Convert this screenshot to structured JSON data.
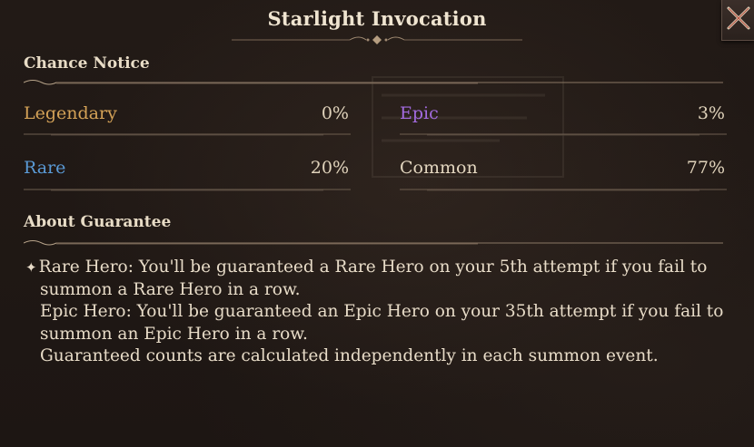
{
  "header": {
    "title": "Starlight Invocation"
  },
  "chance_notice": {
    "heading": "Chance Notice",
    "rates": [
      {
        "label": "Legendary",
        "value": "0%",
        "color": "#d4a257"
      },
      {
        "label": "Epic",
        "value": "3%",
        "color": "#a36be0"
      },
      {
        "label": "Rare",
        "value": "20%",
        "color": "#5a9ad6"
      },
      {
        "label": "Common",
        "value": "77%",
        "color": "#e3d6bf"
      }
    ]
  },
  "guarantee": {
    "heading": "About Guarantee",
    "bullet_icon": "diamond-bullet",
    "lines": [
      "Rare Hero: You'll be guaranteed a Rare Hero on your 5th attempt if you fail to",
      "summon a Rare Hero in a row.",
      "Epic Hero: You'll be guaranteed an Epic Hero on your 35th attempt if you fail to",
      "summon an Epic Hero in a row.",
      "Guaranteed counts are calculated independently in each summon event."
    ]
  },
  "close_icon": "close-x-icon"
}
